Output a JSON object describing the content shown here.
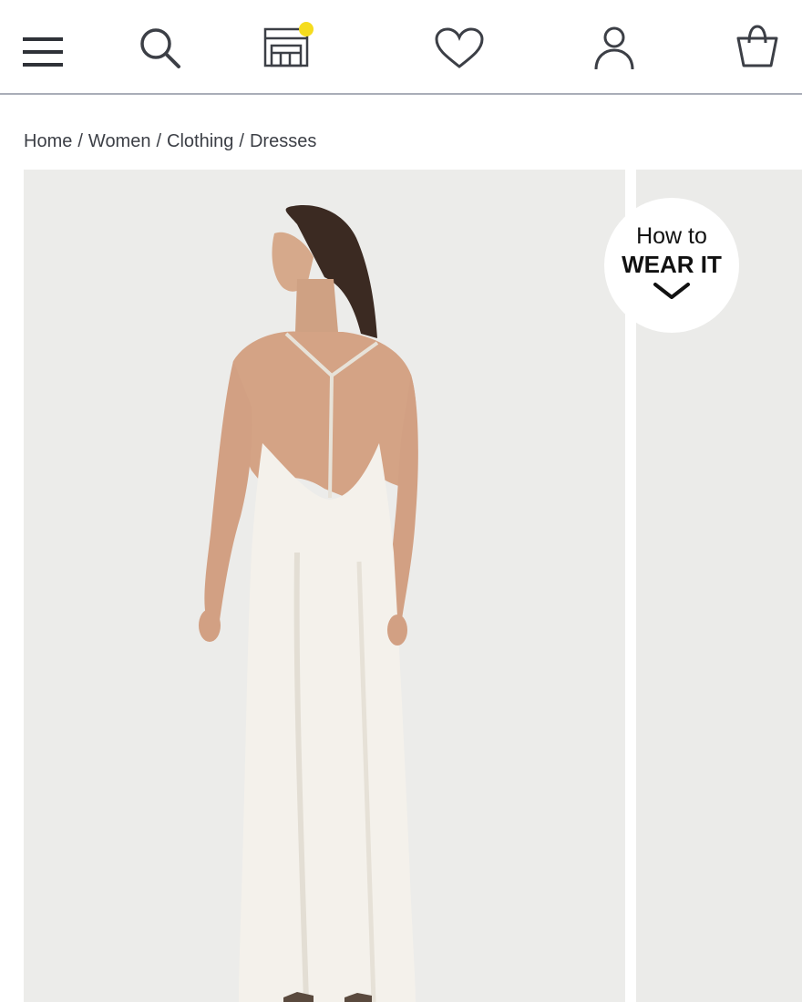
{
  "header": {
    "icons": [
      "menu-icon",
      "search-icon",
      "store-icon",
      "heart-icon",
      "account-icon",
      "bag-icon"
    ],
    "notification_dot_color": "#f5dc1e",
    "icon_color": "#3c3f46"
  },
  "breadcrumb": {
    "items": [
      "Home",
      "Women",
      "Clothing",
      "Dresses"
    ],
    "separator": "/"
  },
  "gallery": {
    "badge": {
      "line1": "How to",
      "line2": "WEAR IT"
    }
  }
}
